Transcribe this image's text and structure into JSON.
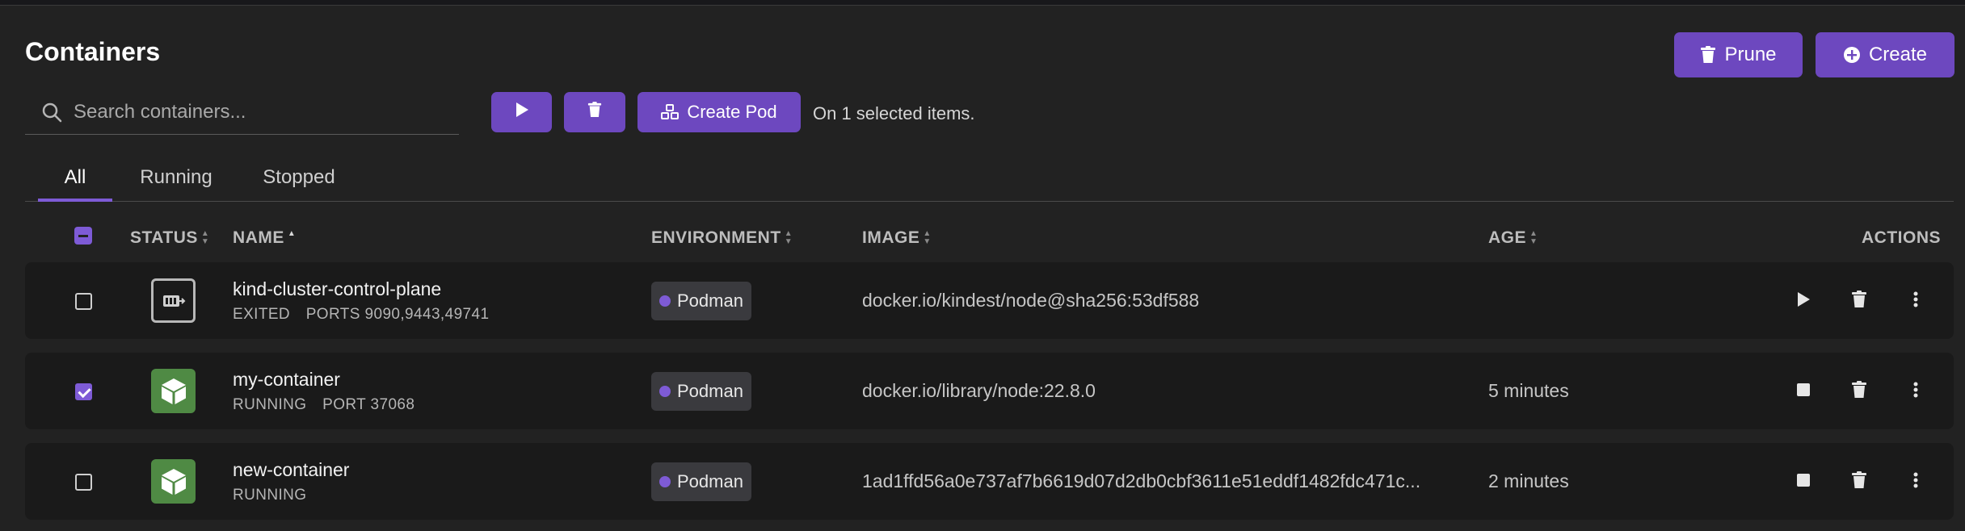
{
  "page": {
    "title": "Containers"
  },
  "header_actions": {
    "prune_label": "Prune",
    "create_label": "Create"
  },
  "search": {
    "placeholder": "Search containers...",
    "value": ""
  },
  "toolbar": {
    "create_pod_label": "Create Pod",
    "selection_note": "On 1 selected items."
  },
  "tabs": [
    {
      "label": "All",
      "active": true
    },
    {
      "label": "Running",
      "active": false
    },
    {
      "label": "Stopped",
      "active": false
    }
  ],
  "columns": {
    "status": "STATUS",
    "name": "NAME",
    "environment": "ENVIRONMENT",
    "image": "IMAGE",
    "age": "AGE",
    "actions": "ACTIONS"
  },
  "rows": [
    {
      "selected": false,
      "state": "exited",
      "name": "kind-cluster-control-plane",
      "status_text": "EXITED",
      "ports": "PORTS 9090,9443,49741",
      "environment": "Podman",
      "image": "docker.io/kindest/node@sha256:53df588",
      "age": ""
    },
    {
      "selected": true,
      "state": "running",
      "name": "my-container",
      "status_text": "RUNNING",
      "ports": "PORT 37068",
      "environment": "Podman",
      "image": "docker.io/library/node:22.8.0",
      "age": "5 minutes"
    },
    {
      "selected": false,
      "state": "running",
      "name": "new-container",
      "status_text": "RUNNING",
      "ports": "",
      "environment": "Podman",
      "image": "1ad1ffd56a0e737af7b6619d07d2db0cbf3611e51eddf1482fdc471c...",
      "age": "2 minutes"
    }
  ],
  "colors": {
    "accent": "#6d48bf",
    "running": "#4f8a44",
    "background": "#222222",
    "row": "#1a1a1a"
  }
}
